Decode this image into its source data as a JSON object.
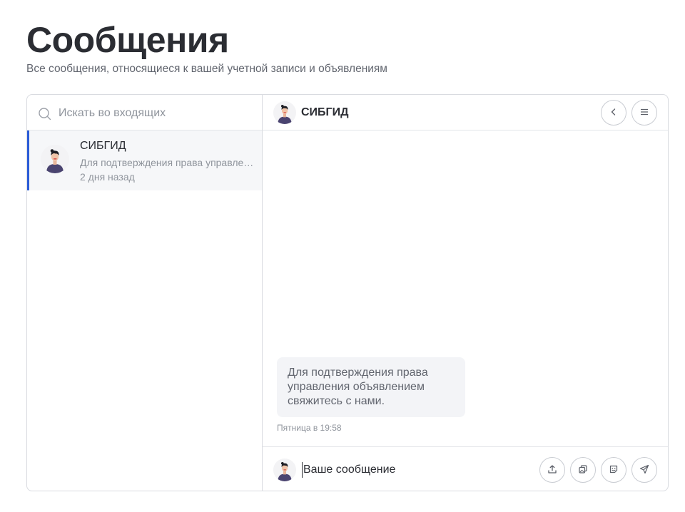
{
  "page": {
    "title": "Сообщения",
    "subtitle": "Все сообщения, относящиеся к вашей учетной записи и объявлениям"
  },
  "search": {
    "placeholder": "Искать во входящих",
    "icon": "search-icon"
  },
  "conversations": [
    {
      "name": "СИБГИД",
      "preview": "Для подтверждения права управления объявлением свяжитесь с нами.",
      "time": "2 дня назад",
      "active": true
    }
  ],
  "chat": {
    "title": "СИБГИД",
    "header_icons": [
      "chevron-left-icon",
      "menu-icon"
    ],
    "messages": [
      {
        "text": "Для подтверждения права управления объявлением свяжитесь с нами.",
        "time": "Пятница в 19:58"
      }
    ]
  },
  "composer": {
    "placeholder": "Ваше сообщение",
    "icons": [
      "upload-icon",
      "gallery-icon",
      "sticker-icon",
      "send-icon"
    ]
  },
  "colors": {
    "accent": "#2a5bd7",
    "text": "#2b2d33",
    "muted": "#8f949c",
    "border": "#d9dbe0",
    "bubble": "#f3f4f7",
    "avatar_shirt": "#4a4470"
  }
}
